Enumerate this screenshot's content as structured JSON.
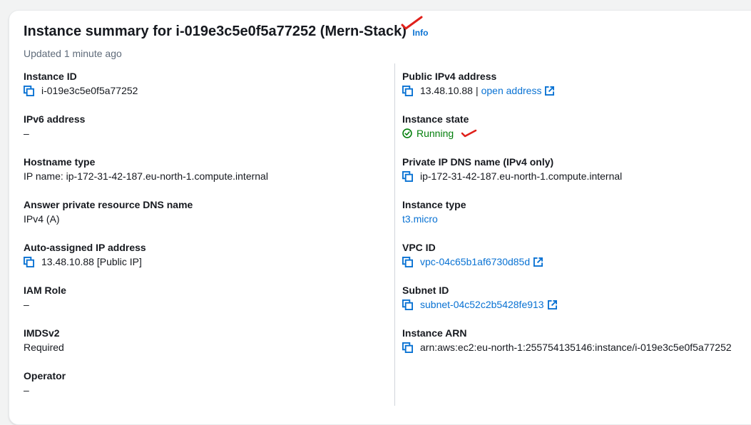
{
  "header": {
    "title": "Instance summary for i-019e3c5e0f5a77252 (Mern-Stack)",
    "info_label": "Info",
    "updated": "Updated 1 minute ago"
  },
  "left": {
    "instance_id": {
      "label": "Instance ID",
      "value": "i-019e3c5e0f5a77252"
    },
    "ipv6": {
      "label": "IPv6 address",
      "value": "–"
    },
    "hostname_type": {
      "label": "Hostname type",
      "value": "IP name: ip-172-31-42-187.eu-north-1.compute.internal"
    },
    "answer_dns": {
      "label": "Answer private resource DNS name",
      "value": "IPv4 (A)"
    },
    "auto_ip": {
      "label": "Auto-assigned IP address",
      "value": "13.48.10.88 [Public IP]"
    },
    "iam_role": {
      "label": "IAM Role",
      "value": "–"
    },
    "imdsv2": {
      "label": "IMDSv2",
      "value": "Required"
    },
    "operator": {
      "label": "Operator",
      "value": "–"
    }
  },
  "right": {
    "public_ipv4": {
      "label": "Public IPv4 address",
      "value": "13.48.10.88",
      "separator": "|",
      "link": "open address"
    },
    "instance_state": {
      "label": "Instance state",
      "value": "Running"
    },
    "private_dns": {
      "label": "Private IP DNS name (IPv4 only)",
      "value": "ip-172-31-42-187.eu-north-1.compute.internal"
    },
    "instance_type": {
      "label": "Instance type",
      "value": "t3.micro"
    },
    "vpc_id": {
      "label": "VPC ID",
      "value": "vpc-04c65b1af6730d85d"
    },
    "subnet_id": {
      "label": "Subnet ID",
      "value": "subnet-04c52c2b5428fe913"
    },
    "instance_arn": {
      "label": "Instance ARN",
      "value": "arn:aws:ec2:eu-north-1:255754135146:instance/i-019e3c5e0f5a77252"
    }
  },
  "icons": {
    "copy": "copy-icon",
    "external": "external-link-icon",
    "status": "status-check-icon",
    "annotation": "red-check-mark"
  },
  "colors": {
    "link": "#0972d3",
    "success": "#037f0c",
    "annotation": "#e0201a"
  }
}
